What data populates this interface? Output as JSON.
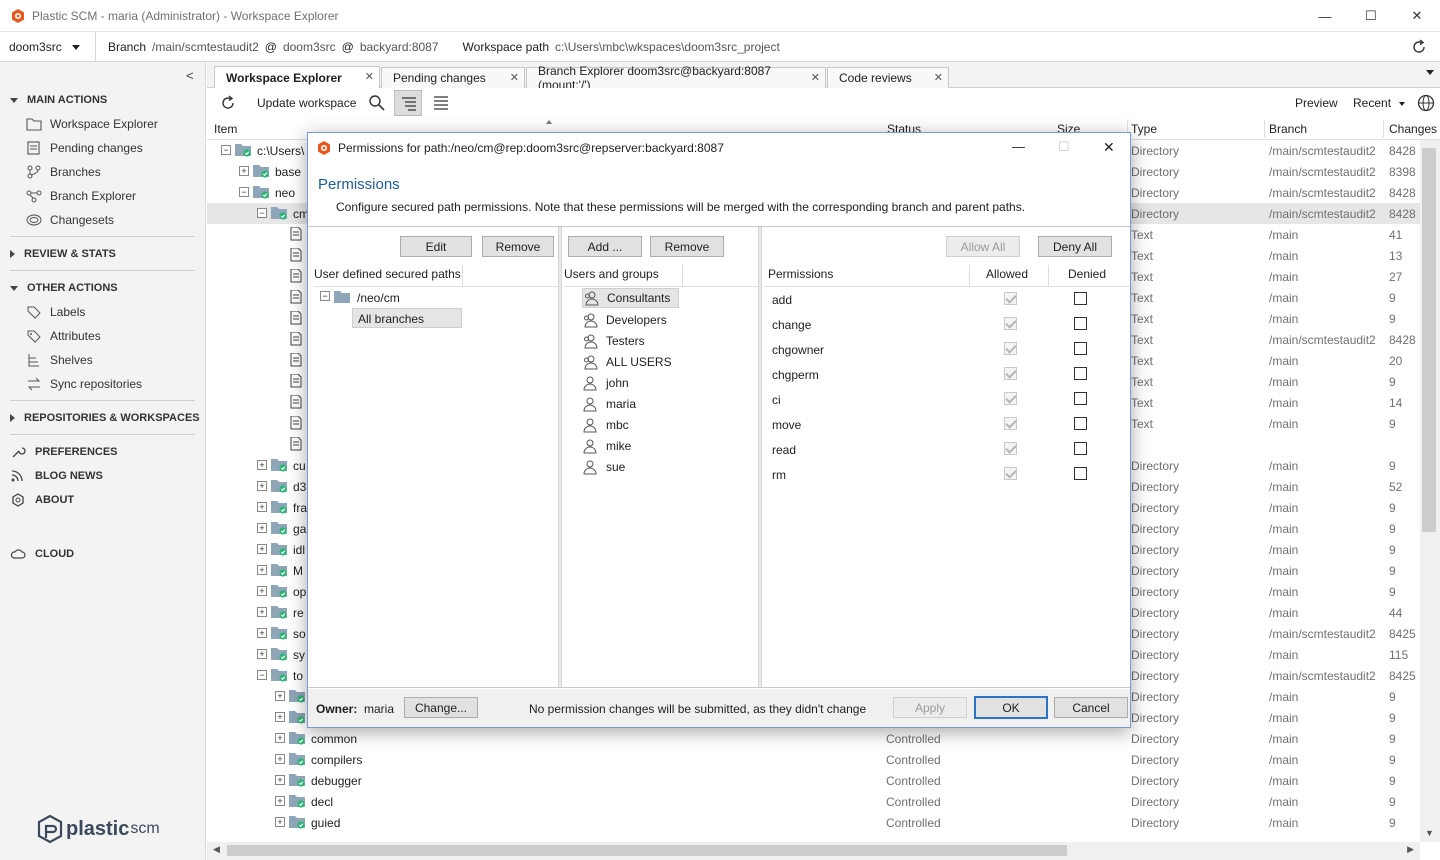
{
  "window": {
    "title": "Plastic SCM - maria (Administrator) - Workspace Explorer",
    "minimize": "—",
    "maximize": "☐",
    "close": "✕"
  },
  "topbar": {
    "workspace": "doom3src",
    "branch_label": "Branch",
    "branch": "/main/scmtestaudit2",
    "at1": "@",
    "repo": "doom3src",
    "at2": "@",
    "server": "backyard:8087",
    "path_label": "Workspace path",
    "path": "c:\\Users\\mbc\\wkspaces\\doom3src_project"
  },
  "sidebar": {
    "collapse": "<",
    "main_actions": "MAIN ACTIONS",
    "main_items": [
      "Workspace Explorer",
      "Pending changes",
      "Branches",
      "Branch Explorer",
      "Changesets"
    ],
    "review": "REVIEW & STATS",
    "other_actions": "OTHER ACTIONS",
    "other_items": [
      "Labels",
      "Attributes",
      "Shelves",
      "Sync repositories"
    ],
    "repos": "REPOSITORIES & WORKSPACES",
    "preferences": "PREFERENCES",
    "blog": "BLOG NEWS",
    "about": "ABOUT",
    "cloud": "CLOUD",
    "brand1": "plastic",
    "brand2": "scm"
  },
  "tabs": [
    {
      "label": "Workspace Explorer"
    },
    {
      "label": "Pending changes"
    },
    {
      "label": "Branch Explorer doom3src@backyard:8087 (mount:'/')"
    },
    {
      "label": "Code reviews"
    }
  ],
  "tab_close": "✕",
  "toolbar": {
    "update": "Update workspace",
    "preview": "Preview",
    "recent": "Recent"
  },
  "grid": {
    "headers": {
      "item": "Item",
      "status": "Status",
      "size": "Size",
      "type": "Type",
      "branch": "Branch",
      "changes": "Changes"
    },
    "rows": [
      {
        "name": "c:\\Users\\",
        "status": "",
        "type": "Directory",
        "branch": "/main/scmtestaudit2",
        "changes": "8428"
      },
      {
        "name": "base",
        "status": "",
        "type": "Directory",
        "branch": "/main/scmtestaudit2",
        "changes": "8398"
      },
      {
        "name": "neo",
        "status": "",
        "type": "Directory",
        "branch": "/main/scmtestaudit2",
        "changes": "8428"
      },
      {
        "name": "cm",
        "status": "",
        "type": "Directory",
        "branch": "/main/scmtestaudit2",
        "changes": "8428"
      },
      {
        "name": "",
        "status": "",
        "type": "Text",
        "branch": "/main",
        "changes": "41"
      },
      {
        "name": "",
        "status": "",
        "type": "Text",
        "branch": "/main",
        "changes": "13"
      },
      {
        "name": "",
        "status": "",
        "type": "Text",
        "branch": "/main",
        "changes": "27"
      },
      {
        "name": "",
        "status": "",
        "type": "Text",
        "branch": "/main",
        "changes": "9"
      },
      {
        "name": "",
        "status": "",
        "type": "Text",
        "branch": "/main",
        "changes": "9"
      },
      {
        "name": "",
        "status": "",
        "type": "Text",
        "branch": "/main/scmtestaudit2",
        "changes": "8428"
      },
      {
        "name": "",
        "status": "",
        "type": "Text",
        "branch": "/main",
        "changes": "20"
      },
      {
        "name": "",
        "status": "",
        "type": "Text",
        "branch": "/main",
        "changes": "9"
      },
      {
        "name": "",
        "status": "",
        "type": "Text",
        "branch": "/main",
        "changes": "14"
      },
      {
        "name": "",
        "status": "",
        "type": "Text",
        "branch": "/main",
        "changes": "9"
      },
      {
        "name": "",
        "status": "",
        "type": "",
        "branch": "",
        "changes": ""
      },
      {
        "name": "cu",
        "status": "",
        "type": "Directory",
        "branch": "/main",
        "changes": "9"
      },
      {
        "name": "d3",
        "status": "",
        "type": "Directory",
        "branch": "/main",
        "changes": "52"
      },
      {
        "name": "fra",
        "status": "",
        "type": "Directory",
        "branch": "/main",
        "changes": "9"
      },
      {
        "name": "ga",
        "status": "",
        "type": "Directory",
        "branch": "/main",
        "changes": "9"
      },
      {
        "name": "idl",
        "status": "",
        "type": "Directory",
        "branch": "/main",
        "changes": "9"
      },
      {
        "name": "M",
        "status": "",
        "type": "Directory",
        "branch": "/main",
        "changes": "9"
      },
      {
        "name": "op",
        "status": "",
        "type": "Directory",
        "branch": "/main",
        "changes": "9"
      },
      {
        "name": "re",
        "status": "",
        "type": "Directory",
        "branch": "/main",
        "changes": "44"
      },
      {
        "name": "so",
        "status": "",
        "type": "Directory",
        "branch": "/main/scmtestaudit2",
        "changes": "8425"
      },
      {
        "name": "sy",
        "status": "",
        "type": "Directory",
        "branch": "/main",
        "changes": "115"
      },
      {
        "name": "to",
        "status": "",
        "type": "Directory",
        "branch": "/main/scmtestaudit2",
        "changes": "8425"
      },
      {
        "name": "",
        "status": "",
        "type": "Directory",
        "branch": "/main",
        "changes": "9"
      },
      {
        "name": "",
        "status": "",
        "type": "Directory",
        "branch": "/main",
        "changes": "9"
      },
      {
        "name": "common",
        "status": "Controlled",
        "type": "Directory",
        "branch": "/main",
        "changes": "9"
      },
      {
        "name": "compilers",
        "status": "Controlled",
        "type": "Directory",
        "branch": "/main",
        "changes": "9"
      },
      {
        "name": "debugger",
        "status": "Controlled",
        "type": "Directory",
        "branch": "/main",
        "changes": "9"
      },
      {
        "name": "decl",
        "status": "Controlled",
        "type": "Directory",
        "branch": "/main",
        "changes": "9"
      },
      {
        "name": "guied",
        "status": "Controlled",
        "type": "Directory",
        "branch": "/main",
        "changes": "9"
      }
    ]
  },
  "dialog": {
    "title": "Permissions for path:/neo/cm@rep:doom3src@repserver:backyard:8087",
    "heading": "Permissions",
    "subtitle": "Configure secured path permissions. Note that these permissions will be merged with the corresponding branch and parent paths.",
    "edit": "Edit",
    "remove1": "Remove",
    "add": "Add ...",
    "remove2": "Remove",
    "allow_all": "Allow All",
    "deny_all": "Deny All",
    "paths_header": "User defined secured paths",
    "users_header": "Users and groups",
    "perm_header": "Permissions",
    "allowed_header": "Allowed",
    "denied_header": "Denied",
    "path_node": "/neo/cm",
    "path_child": "All branches",
    "groups": [
      "Consultants",
      "Developers",
      "Testers",
      "ALL USERS"
    ],
    "users": [
      "john",
      "maria",
      "mbc",
      "mike",
      "sue"
    ],
    "permissions": [
      {
        "name": "add",
        "allowed": true,
        "denied": false
      },
      {
        "name": "change",
        "allowed": true,
        "denied": false
      },
      {
        "name": "chgowner",
        "allowed": true,
        "denied": false
      },
      {
        "name": "chgperm",
        "allowed": true,
        "denied": false
      },
      {
        "name": "ci",
        "allowed": true,
        "denied": false
      },
      {
        "name": "move",
        "allowed": true,
        "denied": false
      },
      {
        "name": "read",
        "allowed": true,
        "denied": false
      },
      {
        "name": "rm",
        "allowed": true,
        "denied": false
      }
    ],
    "owner_label": "Owner:",
    "owner": "maria",
    "change": "Change...",
    "note": "No permission changes will be submitted, as they didn't change",
    "apply": "Apply",
    "ok": "OK",
    "cancel": "Cancel"
  },
  "colors": {
    "accent": "#2c73c7",
    "heading": "#1f5c99",
    "folder": "#8fa5b8",
    "check": "#2bb673",
    "brand_orange": "#e8571c"
  }
}
